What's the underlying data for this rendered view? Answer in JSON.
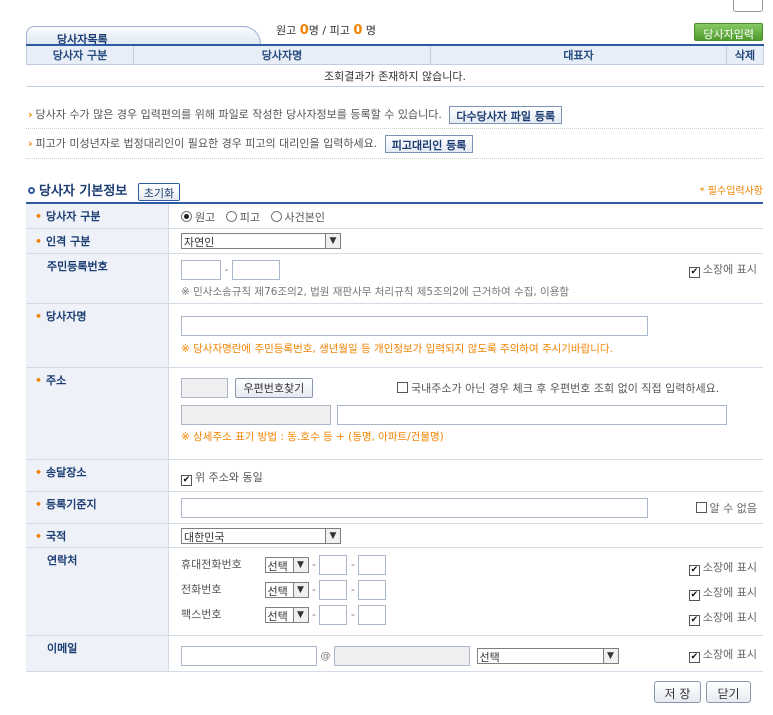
{
  "tab": {
    "label": "당사자목록"
  },
  "counts": {
    "plaintiff_label": "원고",
    "plaintiff_count": "0",
    "plaintiff_unit": "명 /",
    "defendant_label": "피고",
    "defendant_count": "0",
    "defendant_unit": "명"
  },
  "add_button": "당사자입력",
  "list": {
    "headers": [
      "당사자 구분",
      "당사자명",
      "대표자",
      "삭제"
    ],
    "empty": "조회결과가 존재하지 않습니다."
  },
  "notes": {
    "bulk": "당사자 수가 많은 경우 입력편의를 위해 파일로 작성한 당사자정보를 등록할 수 있습니다.",
    "bulk_button": "다수당사자 파일 등록",
    "minor": "피고가 미성년자로 법정대리인이 필요한 경우 피고의 대리인을 입력하세요.",
    "minor_button": "피고대리인 등록"
  },
  "section": {
    "title": "당사자 기본정보",
    "reset": "초기화",
    "required": "* 필수입력사항"
  },
  "form": {
    "party_type": {
      "label": "당사자 구분",
      "options": [
        "원고",
        "피고",
        "사건본인"
      ],
      "selected": "원고"
    },
    "person_type": {
      "label": "인격 구분",
      "value": "자연인"
    },
    "rrn": {
      "label": "주민등록번호",
      "dash": "-",
      "show": "소장에 표시",
      "notice": "※ 민사소송규칙 제76조의2, 법원 재판사무 처리규칙 제5조의2에 근거하여 수집, 이용함"
    },
    "name": {
      "label": "당사자명",
      "notice": "※ 당사자명란에 주민등록번호, 생년월일 등 개인정보가 입력되지 않도록 주의하여 주시기바랍니다."
    },
    "address": {
      "label": "주소",
      "zip_button": "우편번호찾기",
      "foreign": "국내주소가 아닌 경우 체크 후 우편번호 조회 없이 직접 입력하세요.",
      "notice": "※ 상세주소 표기 방법 : 동.호수 등 + (동명, 아파트/건물명)"
    },
    "delivery": {
      "label": "송달장소",
      "same": "위 주소와 동일"
    },
    "register": {
      "label": "등록기준지",
      "unknown": "알 수 없음"
    },
    "nation": {
      "label": "국적",
      "value": "대한민국"
    },
    "contact": {
      "label": "연락처",
      "rows": [
        {
          "label": "휴대전화번호",
          "select": "선택",
          "show": "소장에 표시"
        },
        {
          "label": "전화번호",
          "select": "선택",
          "show": "소장에 표시"
        },
        {
          "label": "팩스번호",
          "select": "선택",
          "show": "소장에 표시"
        }
      ],
      "dash": "-"
    },
    "email": {
      "label": "이메일",
      "at": "@",
      "select": "선택",
      "show": "소장에 표시"
    }
  },
  "buttons": {
    "save": "저 장",
    "close": "닫기"
  }
}
